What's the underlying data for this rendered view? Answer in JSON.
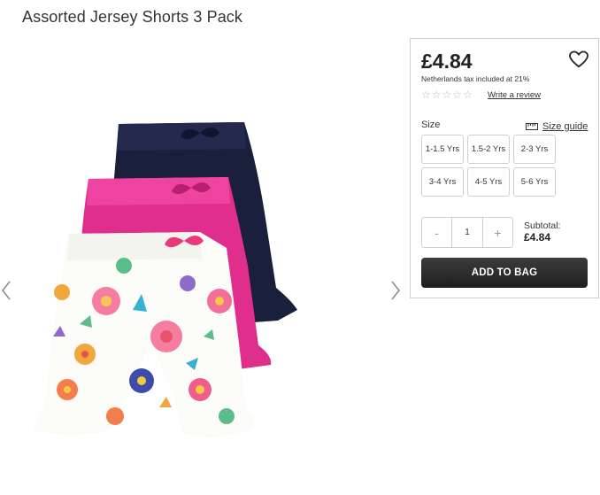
{
  "product": {
    "title": "Assorted Jersey Shorts 3 Pack",
    "price": "£4.84",
    "tax_note": "Netherlands tax included at 21%",
    "rating_stars": 0,
    "write_review": "Write a review"
  },
  "size": {
    "label": "Size",
    "guide_label": "Size guide",
    "options": [
      "1-1.5 Yrs",
      "1.5-2 Yrs",
      "2-3 Yrs",
      "3-4 Yrs",
      "4-5 Yrs",
      "5-6 Yrs"
    ]
  },
  "quantity": {
    "minus": "-",
    "value": "1",
    "plus": "+"
  },
  "subtotal": {
    "label": "Subtotal:",
    "value": "£4.84"
  },
  "actions": {
    "add_to_bag": "ADD TO BAG"
  },
  "icons": {
    "prev": "chevron-left-icon",
    "next": "chevron-right-icon",
    "wishlist": "heart-icon",
    "size_guide": "ruler-icon",
    "rating": "star-icon"
  },
  "colors": {
    "navy_short": "#1a1f3c",
    "pink_short": "#e0318f",
    "button_dark": "#2a2a2a"
  }
}
